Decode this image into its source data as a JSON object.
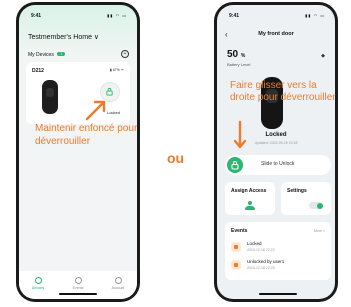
{
  "left_screen": {
    "time": "9:41",
    "home_title": "Testmember's Home ∨",
    "devices_label": "My Devices",
    "devices_count": "1",
    "device": {
      "name": "D212",
      "battery": "▮ 67% ᯤ",
      "status": "Locked"
    },
    "tabs": [
      {
        "label": "Devices"
      },
      {
        "label": "Events"
      },
      {
        "label": "Account"
      }
    ]
  },
  "hint_left": "Maintenir enfoncé pour déverrouiller",
  "or_label": "ou",
  "hint_right": "Faire glisser vers la droite pour déverrouiller",
  "right_screen": {
    "time": "9:41",
    "title": "My front door",
    "battery_value": "50",
    "battery_unit": "%",
    "battery_label": "Battery Level",
    "lock_status": "Locked",
    "updated": "Updated: 2024-09-25 10:18",
    "slide_label": "Slide to Unlock",
    "assign_access": "Assign Access",
    "settings": "Settings",
    "events_title": "Events",
    "events_more": "More >",
    "events": [
      {
        "title": "Locked",
        "time": "2024-12-18 22:22"
      },
      {
        "title": "Unlocked by user1",
        "time": "2024-12-18 22:20"
      }
    ]
  },
  "colors": {
    "accent": "#2bb673",
    "hint": "#ee7b2c"
  }
}
